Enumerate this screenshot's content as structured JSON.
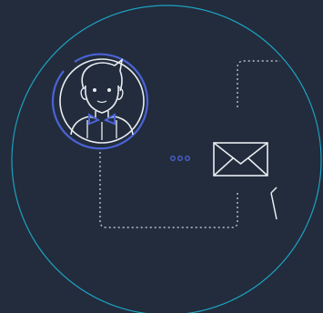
{
  "colors": {
    "background": "#222c3c",
    "ring": "#1ea2c2",
    "accent_blue": "#4a63d6",
    "line_white": "#e9edf2",
    "dotted": "#d7dbe2"
  },
  "icons": {
    "person": "user-avatar-icon",
    "envelope": "envelope-icon",
    "typing": "ellipsis-icon",
    "cursor": "pointer-cursor-icon"
  }
}
